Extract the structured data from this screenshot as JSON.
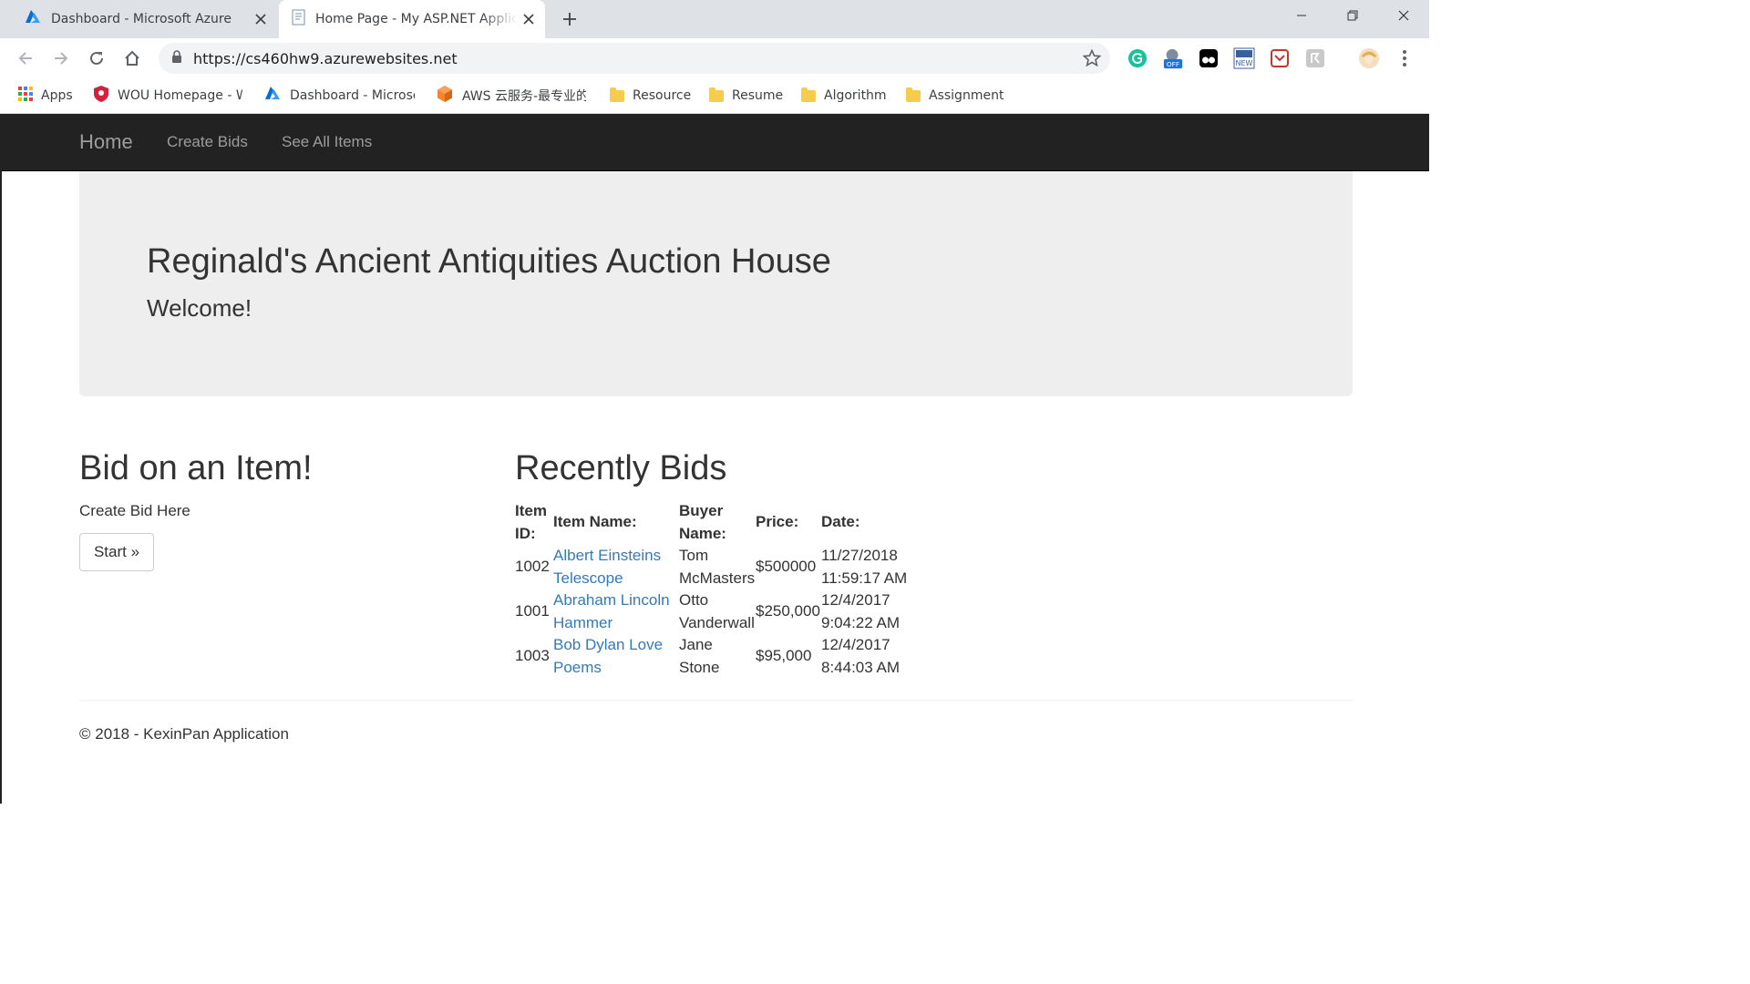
{
  "browser": {
    "tabs": [
      {
        "title": "Dashboard - Microsoft Azure",
        "icon": "azure-icon"
      },
      {
        "title": "Home Page - My ASP.NET Application",
        "icon": "document-icon"
      }
    ],
    "url": "https://cs460hw9.azurewebsites.net",
    "bookmarks": [
      {
        "label": "Apps",
        "icon": "apps-grid-icon"
      },
      {
        "label": "WOU Homepage - W",
        "icon": "wou-shield-icon"
      },
      {
        "label": "Dashboard - Microso",
        "icon": "azure-icon"
      },
      {
        "label": "AWS 云服务-最专业的",
        "icon": "aws-cube-icon"
      },
      {
        "label": "Resource",
        "icon": "folder-icon"
      },
      {
        "label": "Resume",
        "icon": "folder-icon"
      },
      {
        "label": "Algorithm",
        "icon": "folder-icon"
      },
      {
        "label": "Assignment",
        "icon": "folder-icon"
      }
    ],
    "extension_badge": "OFF",
    "extension_new": "NEW"
  },
  "nav": {
    "brand": "Home",
    "links": [
      "Create Bids",
      "See All Items"
    ]
  },
  "hero": {
    "title": "Reginald's Ancient Antiquities Auction House",
    "subtitle": "Welcome!"
  },
  "bid": {
    "title": "Bid on an Item!",
    "text": "Create Bid Here",
    "button": "Start »"
  },
  "recent": {
    "title": "Recently Bids",
    "headers": [
      [
        "Item",
        "ID:"
      ],
      [
        "Item Name:"
      ],
      [
        "Buyer",
        "Name:"
      ],
      [
        "Price:"
      ],
      [
        "Date:"
      ]
    ],
    "rows": [
      {
        "id": "1002",
        "name": [
          "Albert Einsteins",
          "Telescope"
        ],
        "buyer": [
          "Tom",
          "McMasters"
        ],
        "price": "$500000",
        "date": [
          "11/27/2018",
          "11:59:17 AM"
        ]
      },
      {
        "id": "1001",
        "name": [
          "Abraham Lincoln",
          "Hammer"
        ],
        "buyer": [
          "Otto",
          "Vanderwall"
        ],
        "price": "$250,000",
        "date": [
          "12/4/2017",
          "9:04:22 AM"
        ]
      },
      {
        "id": "1003",
        "name": [
          "Bob Dylan Love",
          "Poems"
        ],
        "buyer": [
          "Jane",
          "Stone"
        ],
        "price": "$95,000",
        "date": [
          "12/4/2017",
          "8:44:03 AM"
        ]
      }
    ]
  },
  "footer": "© 2018 - KexinPan Application",
  "colors": {
    "navbar": "#222222",
    "nav_text": "#9d9d9d",
    "jumbotron": "#eeeeee",
    "link": "#337ab7",
    "tabstrip": "#dee1e6"
  }
}
